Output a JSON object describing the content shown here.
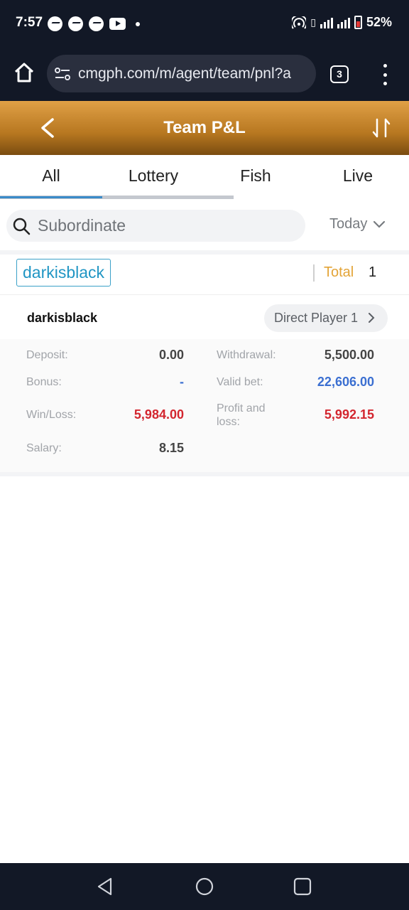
{
  "status_bar": {
    "time": "7:57",
    "battery": "52%",
    "app_icons": [
      "messenger-icon",
      "messenger-icon",
      "messenger-icon",
      "youtube-icon"
    ]
  },
  "browser": {
    "url": "cmgph.com/m/agent/team/pnl?a",
    "tab_count": "3"
  },
  "header": {
    "title": "Team P&L"
  },
  "tabs": [
    {
      "label": "All",
      "active": true
    },
    {
      "label": "Lottery",
      "active": false
    },
    {
      "label": "Fish",
      "active": false
    },
    {
      "label": "Live",
      "active": false
    }
  ],
  "filter": {
    "search_placeholder": "Subordinate",
    "date_range": "Today"
  },
  "summary": {
    "user_chip": "darkisblack",
    "total_label": "Total",
    "total_value": "1"
  },
  "record": {
    "username": "darkisblack",
    "direct_player_label": "Direct Player 1",
    "stats": {
      "deposit": {
        "label": "Deposit:",
        "value": "0.00"
      },
      "withdrawal": {
        "label": "Withdrawal:",
        "value": "5,500.00"
      },
      "bonus": {
        "label": "Bonus:",
        "value": "-"
      },
      "valid_bet": {
        "label": "Valid bet:",
        "value": "22,606.00"
      },
      "win_loss": {
        "label": "Win/Loss:",
        "value": "5,984.00"
      },
      "profit_loss_line1": {
        "label": "Profit and"
      },
      "profit_loss_line2": {
        "label": "loss:"
      },
      "profit_loss": {
        "value": "5,992.15"
      },
      "salary": {
        "label": "Salary:",
        "value": "8.15"
      }
    }
  },
  "colors": {
    "header_gold": "#b77720",
    "accent_blue": "#3a8bc9",
    "value_red": "#d3262f",
    "value_blue": "#3b6fd1",
    "total_orange": "#e3a437"
  }
}
